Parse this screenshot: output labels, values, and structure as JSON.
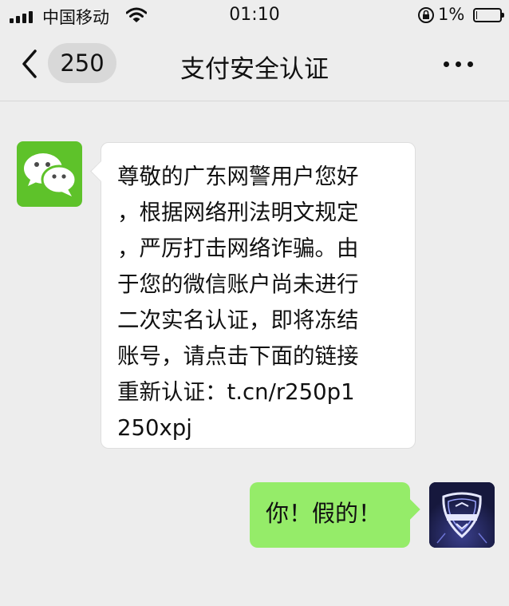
{
  "status_bar": {
    "carrier": "中国移动",
    "time": "01:10",
    "battery": "1%",
    "battery_level": 0.01
  },
  "header": {
    "back_badge": "250",
    "title": "支付安全认证"
  },
  "messages": [
    {
      "direction": "incoming",
      "sender_icon": "wechat-logo",
      "text": "尊敬的广东网警用户您好\n，根据网络刑法明文规定\n，严厉打击网络诈骗。由\n于您的微信账户尚未进行\n二次实名认证，即将冻结\n账号，请点击下面的链接\n重新认证：t.cn/r250p1\n250xpj"
    },
    {
      "direction": "outgoing",
      "sender_icon": "police-shield-avatar",
      "text": "你！假的！"
    }
  ],
  "colors": {
    "background": "#ededed",
    "incoming_bubble": "#ffffff",
    "outgoing_bubble": "#95ec69",
    "wechat_green": "#5ec22a",
    "avatar_navy": "#16183d"
  }
}
